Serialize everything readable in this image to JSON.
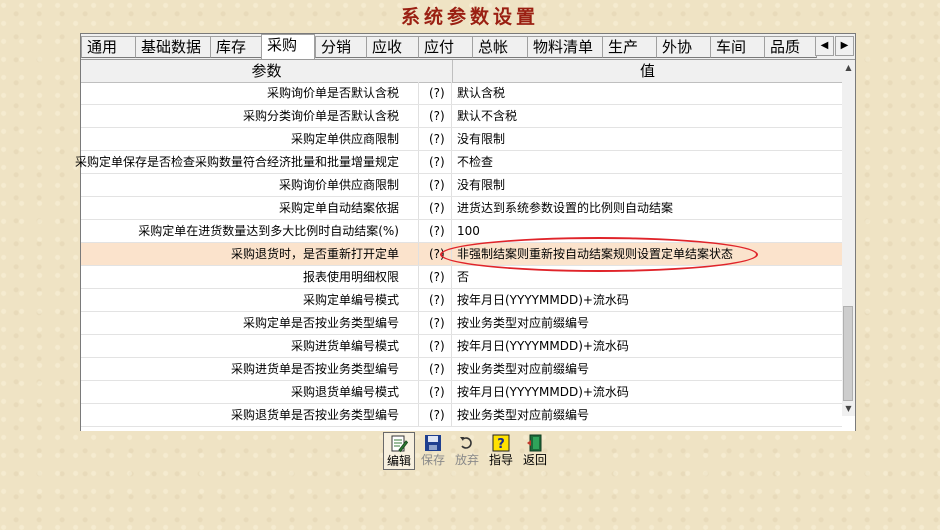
{
  "window": {
    "title": "系统参数设置"
  },
  "tabs": [
    {
      "label": "通用"
    },
    {
      "label": "基础数据"
    },
    {
      "label": "库存"
    },
    {
      "label": "采购",
      "active": true
    },
    {
      "label": "分销"
    },
    {
      "label": "应收"
    },
    {
      "label": "应付"
    },
    {
      "label": "总帐"
    },
    {
      "label": "物料清单"
    },
    {
      "label": "生产"
    },
    {
      "label": "外协"
    },
    {
      "label": "车间"
    },
    {
      "label": "品质"
    }
  ],
  "tab_scroll": {
    "left_icon": "triangle-left-icon",
    "right_icon": "triangle-right-icon"
  },
  "grid": {
    "headers": {
      "param": "参数",
      "value": "值"
    },
    "rows": [
      {
        "param": "采购询价单是否默认含税",
        "q": "(?)",
        "value": "默认含税"
      },
      {
        "param": "采购分类询价单是否默认含税",
        "q": "(?)",
        "value": "默认不含税"
      },
      {
        "param": "采购定单供应商限制",
        "q": "(?)",
        "value": "没有限制"
      },
      {
        "param": "采购定单保存是否检查采购数量符合经济批量和批量增量规定",
        "q": "(?)",
        "value": "不检查"
      },
      {
        "param": "采购询价单供应商限制",
        "q": "(?)",
        "value": "没有限制"
      },
      {
        "param": "采购定单自动结案依据",
        "q": "(?)",
        "value": "进货达到系统参数设置的比例则自动结案"
      },
      {
        "param": "采购定单在进货数量达到多大比例时自动结案(%)",
        "q": "(?)",
        "value": "100"
      },
      {
        "param": "采购退货时，是否重新打开定单",
        "q": "(?)",
        "value": "非强制结案则重新按自动结案规则设置定单结案状态",
        "highlighted": true
      },
      {
        "param": "报表使用明细权限",
        "q": "(?)",
        "value": "否"
      },
      {
        "param": "采购定单编号模式",
        "q": "(?)",
        "value": "按年月日(YYYYMMDD)+流水码"
      },
      {
        "param": "采购定单是否按业务类型编号",
        "q": "(?)",
        "value": "按业务类型对应前缀编号"
      },
      {
        "param": "采购进货单编号模式",
        "q": "(?)",
        "value": "按年月日(YYYYMMDD)+流水码"
      },
      {
        "param": "采购进货单是否按业务类型编号",
        "q": "(?)",
        "value": "按业务类型对应前缀编号"
      },
      {
        "param": "采购退货单编号模式",
        "q": "(?)",
        "value": "按年月日(YYYYMMDD)+流水码"
      },
      {
        "param": "采购退货单是否按业务类型编号",
        "q": "(?)",
        "value": "按业务类型对应前缀编号"
      }
    ]
  },
  "scroll_position": 0.8,
  "toolbar": {
    "edit": {
      "label": "编辑",
      "icon": "edit-icon"
    },
    "save": {
      "label": "保存",
      "icon": "floppy-disk-icon",
      "disabled": true
    },
    "discard": {
      "label": "放弃",
      "icon": "undo-icon",
      "disabled": true
    },
    "guide": {
      "label": "指导",
      "icon": "help-icon"
    },
    "back": {
      "label": "返回",
      "icon": "exit-door-icon"
    }
  },
  "colors": {
    "title": "#9a1f12",
    "highlight_row": "#fbe3cc",
    "annotation_ellipse": "#e0242a",
    "background": "#efe3c4"
  }
}
